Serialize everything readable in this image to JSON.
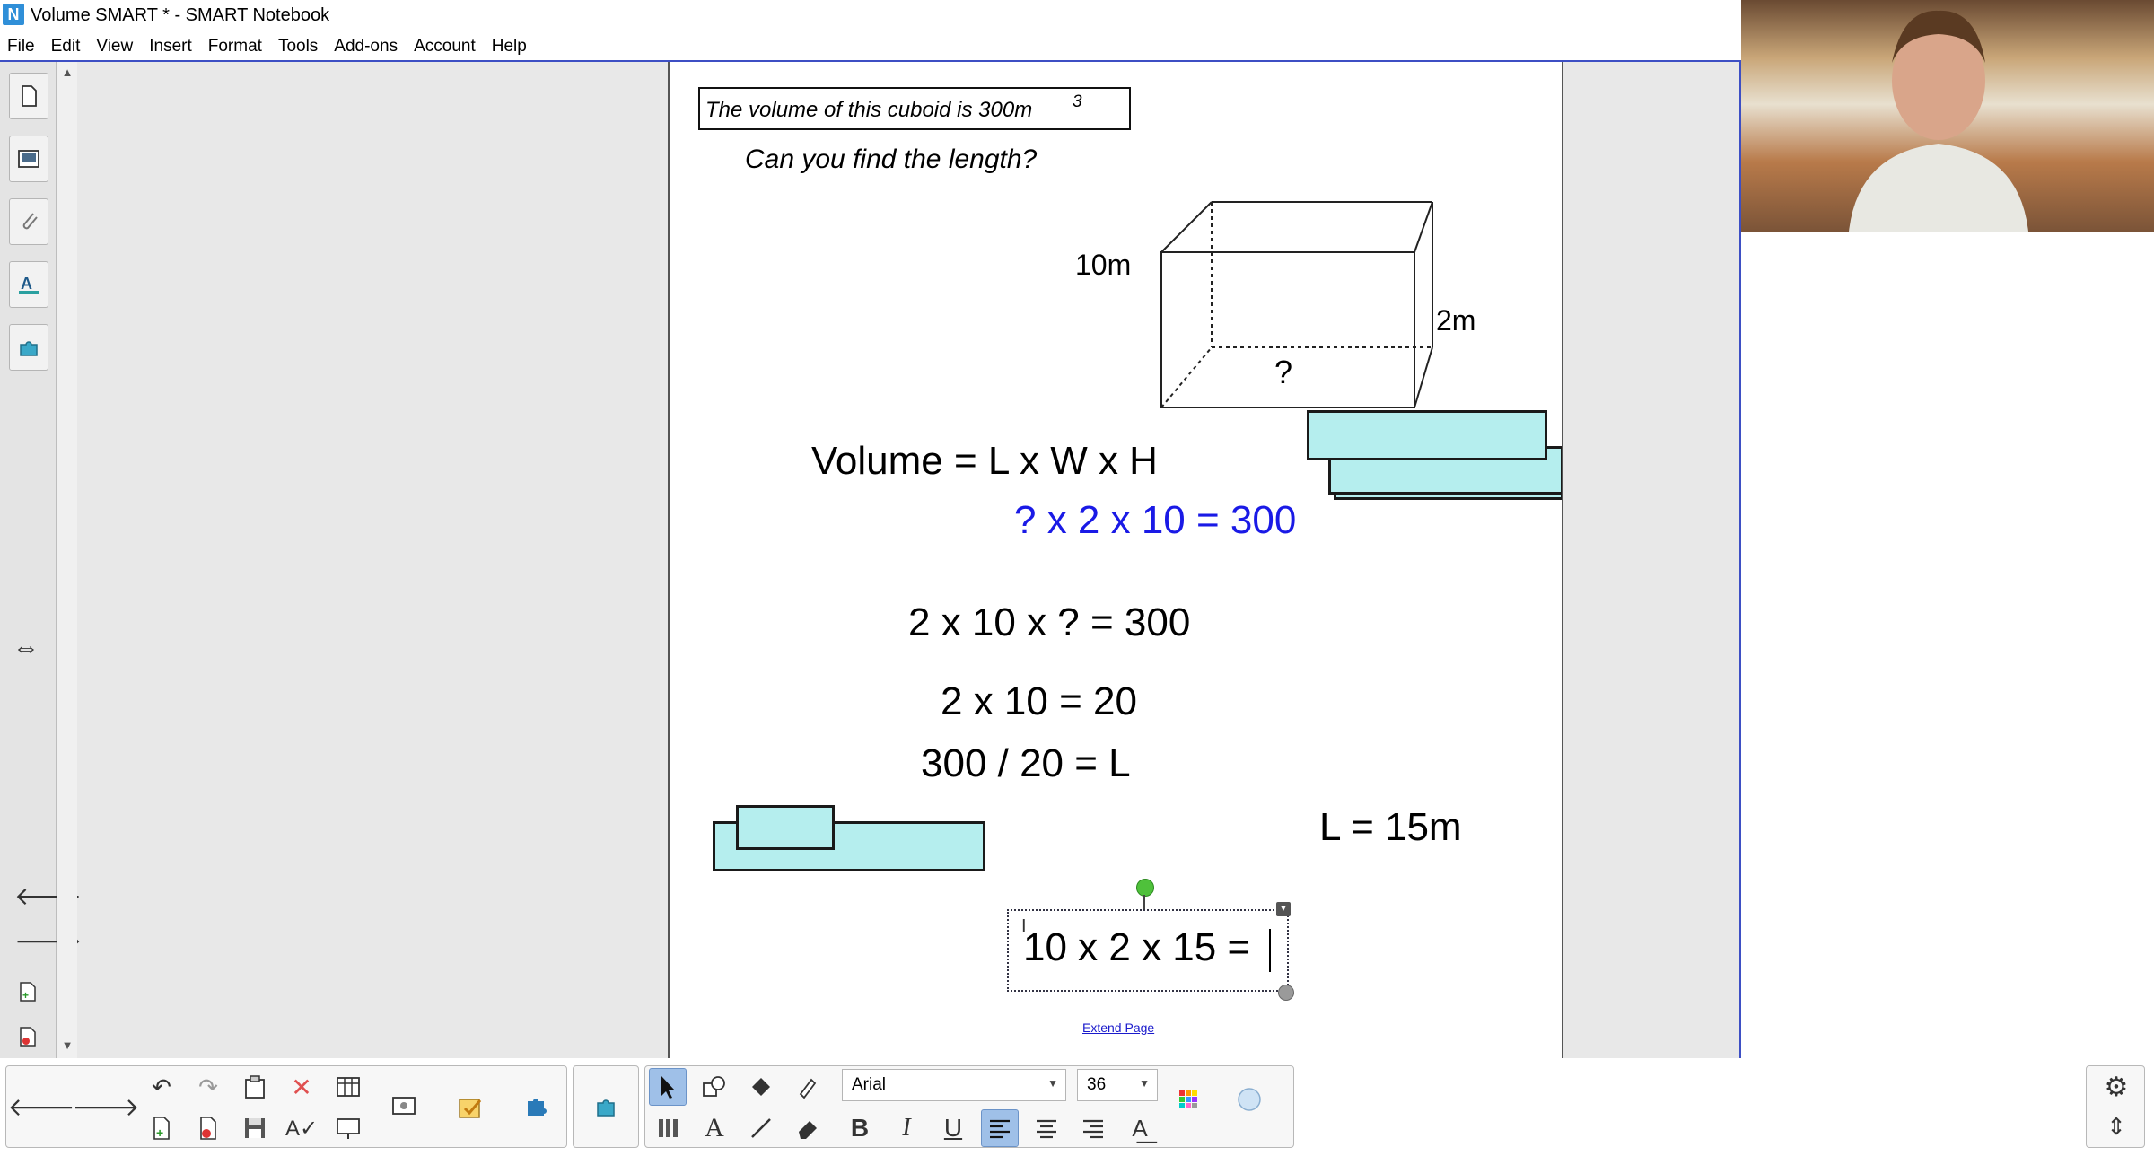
{
  "window": {
    "title": "Volume SMART * - SMART Notebook",
    "app_icon": "smart-notebook-icon"
  },
  "menu": [
    "File",
    "Edit",
    "View",
    "Insert",
    "Format",
    "Tools",
    "Add-ons",
    "Account",
    "Help"
  ],
  "side_tabs": [
    {
      "name": "page-sorter-icon"
    },
    {
      "name": "gallery-icon"
    },
    {
      "name": "attachments-icon"
    },
    {
      "name": "properties-icon"
    },
    {
      "name": "add-ons-icon"
    }
  ],
  "page": {
    "cuboid_title": "The volume of this cuboid is 300m",
    "cuboid_title_sup": "3",
    "question": "Can you find the length?",
    "height_label": "10m",
    "depth_label": "2m",
    "length_label": "?",
    "formula": "Volume  =  L x W x H",
    "blue_equation": "?  x 2 x 10 = 300",
    "equation_1": "2 x 10 x ? = 300",
    "equation_2": "2 x 10 = 20",
    "equation_3": "300 / 20 = L",
    "answer": "L  = 15m",
    "editing_text": "10 x 2  x 15 =",
    "extend_page": "Extend Page"
  },
  "toolbar": {
    "font": "Arial",
    "font_size": "36",
    "colors": {
      "accent_active": "#9fc0e8",
      "frame": "#3d4fc4",
      "blue_text": "#1a1ae6",
      "shape_fill": "#b5eeee"
    }
  }
}
